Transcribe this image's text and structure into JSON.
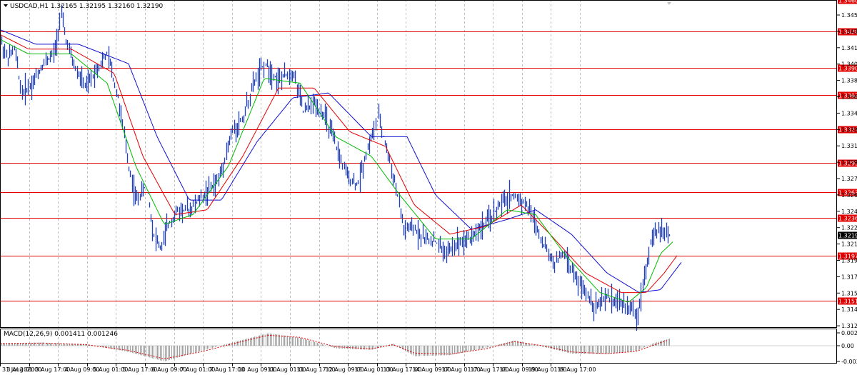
{
  "window": {
    "symbol_caption": "USDCAD,H1  1.32165 1.32195 1.32160 1.32190"
  },
  "macd": {
    "caption": "MACD(12,26,9) 0.001411 0.001246",
    "axis_labels": [
      "0.00245",
      "0.00",
      "-0.00330"
    ]
  },
  "price_axis": {
    "labels": [
      "1.34520",
      "1.34350",
      "1.34175",
      "1.34000",
      "1.33830",
      "1.33655",
      "1.33485",
      "1.33310",
      "1.33140",
      "1.32965",
      "1.32795",
      "1.32620",
      "1.32450",
      "1.32280",
      "1.32105",
      "1.31935",
      "1.31760",
      "1.31590",
      "1.31415",
      "1.31245"
    ],
    "current_price": "1.32190"
  },
  "levels": [
    {
      "label": "1.34604",
      "price": 1.34604
    },
    {
      "label": "1.34282",
      "price": 1.34282
    },
    {
      "label": "1.33908",
      "price": 1.33908
    },
    {
      "label": "1.33626",
      "price": 1.33626
    },
    {
      "label": "1.33278",
      "price": 1.33278
    },
    {
      "label": "1.32934",
      "price": 1.32934
    },
    {
      "label": "1.32633",
      "price": 1.32633
    },
    {
      "label": "1.32368",
      "price": 1.32368
    },
    {
      "label": "1.31978",
      "price": 1.31978
    },
    {
      "label": "1.31514",
      "price": 1.31514
    }
  ],
  "time_axis": {
    "labels": [
      "31 Jul 2020",
      "3 Aug 01:00",
      "3 Aug 17:00",
      "4 Aug 09:00",
      "5 Aug 01:00",
      "5 Aug 17:00",
      "6 Aug 09:00",
      "7 Aug 01:00",
      "7 Aug 17:00",
      "10 Aug 09:00",
      "11 Aug 01:00",
      "11 Aug 17:00",
      "12 Aug 09:00",
      "13 Aug 01:00",
      "13 Aug 17:00",
      "14 Aug 09:00",
      "17 Aug 01:00",
      "17 Aug 17:00",
      "18 Aug 09:00",
      "19 Aug 01:00",
      "19 Aug 17:00"
    ]
  },
  "colors": {
    "background": "#ffffff",
    "price_bars": "#1f3fbf",
    "level_line": "#e00000",
    "level_label_bg": "#e00000",
    "current_price_bg": "#000000",
    "ma_fast": "#00bb00",
    "ma_mid": "#e00000",
    "ma_slow": "#1010d0",
    "grid": "#bdbdbd",
    "macd_hist": "#a0a0a0",
    "macd_signal": "#e00000"
  },
  "chart_data": {
    "type": "line",
    "price_path": [
      [
        0,
        1.342
      ],
      [
        10,
        1.34
      ],
      [
        20,
        1.341
      ],
      [
        30,
        1.3365
      ],
      [
        45,
        1.3375
      ],
      [
        60,
        1.3395
      ],
      [
        75,
        1.3405
      ],
      [
        85,
        1.3445
      ],
      [
        95,
        1.341
      ],
      [
        105,
        1.339
      ],
      [
        120,
        1.337
      ],
      [
        135,
        1.339
      ],
      [
        150,
        1.3405
      ],
      [
        165,
        1.336
      ],
      [
        180,
        1.329
      ],
      [
        190,
        1.3255
      ],
      [
        205,
        1.327
      ],
      [
        215,
        1.322
      ],
      [
        225,
        1.3205
      ],
      [
        235,
        1.323
      ],
      [
        250,
        1.3245
      ],
      [
        265,
        1.3245
      ],
      [
        285,
        1.326
      ],
      [
        305,
        1.3275
      ],
      [
        325,
        1.3325
      ],
      [
        340,
        1.334
      ],
      [
        355,
        1.3375
      ],
      [
        370,
        1.3395
      ],
      [
        390,
        1.3378
      ],
      [
        410,
        1.3388
      ],
      [
        425,
        1.3345
      ],
      [
        440,
        1.3355
      ],
      [
        455,
        1.334
      ],
      [
        470,
        1.331
      ],
      [
        485,
        1.328
      ],
      [
        500,
        1.327
      ],
      [
        515,
        1.331
      ],
      [
        530,
        1.334
      ],
      [
        545,
        1.3295
      ],
      [
        555,
        1.3265
      ],
      [
        565,
        1.3225
      ],
      [
        580,
        1.3225
      ],
      [
        595,
        1.3215
      ],
      [
        610,
        1.3212
      ],
      [
        625,
        1.32
      ],
      [
        640,
        1.3212
      ],
      [
        655,
        1.3215
      ],
      [
        670,
        1.3225
      ],
      [
        685,
        1.3235
      ],
      [
        700,
        1.325
      ],
      [
        715,
        1.326
      ],
      [
        730,
        1.3255
      ],
      [
        745,
        1.324
      ],
      [
        760,
        1.321
      ],
      [
        775,
        1.319
      ],
      [
        790,
        1.32
      ],
      [
        805,
        1.3175
      ],
      [
        820,
        1.316
      ],
      [
        835,
        1.3145
      ],
      [
        850,
        1.3155
      ],
      [
        865,
        1.315
      ],
      [
        880,
        1.3145
      ],
      [
        892,
        1.3135
      ],
      [
        900,
        1.317
      ],
      [
        912,
        1.3215
      ],
      [
        925,
        1.3225
      ],
      [
        938,
        1.3219
      ]
    ],
    "ma_fast_path": [
      [
        0,
        1.342
      ],
      [
        40,
        1.3405
      ],
      [
        100,
        1.3405
      ],
      [
        150,
        1.3375
      ],
      [
        190,
        1.329
      ],
      [
        230,
        1.323
      ],
      [
        270,
        1.324
      ],
      [
        320,
        1.329
      ],
      [
        370,
        1.338
      ],
      [
        420,
        1.3375
      ],
      [
        470,
        1.332
      ],
      [
        520,
        1.33
      ],
      [
        560,
        1.326
      ],
      [
        610,
        1.3215
      ],
      [
        660,
        1.3215
      ],
      [
        710,
        1.3245
      ],
      [
        750,
        1.324
      ],
      [
        790,
        1.32
      ],
      [
        840,
        1.316
      ],
      [
        880,
        1.315
      ],
      [
        905,
        1.3165
      ],
      [
        925,
        1.32
      ],
      [
        942,
        1.3212
      ]
    ],
    "ma_mid_path": [
      [
        0,
        1.3425
      ],
      [
        40,
        1.341
      ],
      [
        100,
        1.341
      ],
      [
        160,
        1.3385
      ],
      [
        200,
        1.33
      ],
      [
        245,
        1.324
      ],
      [
        290,
        1.3245
      ],
      [
        340,
        1.33
      ],
      [
        390,
        1.337
      ],
      [
        440,
        1.337
      ],
      [
        490,
        1.3325
      ],
      [
        540,
        1.331
      ],
      [
        580,
        1.325
      ],
      [
        630,
        1.322
      ],
      [
        680,
        1.3228
      ],
      [
        730,
        1.325
      ],
      [
        770,
        1.322
      ],
      [
        820,
        1.318
      ],
      [
        870,
        1.316
      ],
      [
        905,
        1.316
      ],
      [
        930,
        1.318
      ],
      [
        948,
        1.3198
      ]
    ],
    "ma_slow_path": [
      [
        0,
        1.343
      ],
      [
        50,
        1.3415
      ],
      [
        110,
        1.3415
      ],
      [
        180,
        1.3395
      ],
      [
        220,
        1.332
      ],
      [
        265,
        1.3255
      ],
      [
        310,
        1.3255
      ],
      [
        360,
        1.3315
      ],
      [
        410,
        1.336
      ],
      [
        460,
        1.3365
      ],
      [
        520,
        1.332
      ],
      [
        570,
        1.332
      ],
      [
        610,
        1.326
      ],
      [
        660,
        1.3225
      ],
      [
        710,
        1.3235
      ],
      [
        750,
        1.3245
      ],
      [
        800,
        1.322
      ],
      [
        850,
        1.318
      ],
      [
        895,
        1.316
      ],
      [
        925,
        1.3163
      ],
      [
        955,
        1.3192
      ]
    ],
    "macd_histogram": [
      [
        0,
        0.0005
      ],
      [
        60,
        0.0006
      ],
      [
        120,
        0.0003
      ],
      [
        180,
        -0.0012
      ],
      [
        230,
        -0.003
      ],
      [
        280,
        -0.001
      ],
      [
        330,
        0.0008
      ],
      [
        375,
        0.0024
      ],
      [
        420,
        0.0015
      ],
      [
        470,
        -0.0005
      ],
      [
        520,
        -0.0008
      ],
      [
        550,
        0.0004
      ],
      [
        580,
        -0.002
      ],
      [
        630,
        -0.0018
      ],
      [
        680,
        -0.0004
      ],
      [
        720,
        0.001
      ],
      [
        760,
        -0.0002
      ],
      [
        800,
        -0.0015
      ],
      [
        850,
        -0.0016
      ],
      [
        890,
        -0.001
      ],
      [
        915,
        0.0005
      ],
      [
        938,
        0.0014
      ]
    ],
    "macd_signal": [
      [
        0,
        0.0004
      ],
      [
        60,
        0.0005
      ],
      [
        120,
        0.0002
      ],
      [
        180,
        -0.0009
      ],
      [
        230,
        -0.0025
      ],
      [
        280,
        -0.0012
      ],
      [
        330,
        0.0005
      ],
      [
        375,
        0.002
      ],
      [
        420,
        0.0016
      ],
      [
        470,
        -0.0002
      ],
      [
        520,
        -0.0006
      ],
      [
        550,
        0.0002
      ],
      [
        580,
        -0.0014
      ],
      [
        630,
        -0.0016
      ],
      [
        680,
        -0.0006
      ],
      [
        720,
        0.0008
      ],
      [
        760,
        0.0
      ],
      [
        800,
        -0.0012
      ],
      [
        850,
        -0.0015
      ],
      [
        890,
        -0.0011
      ],
      [
        915,
        0.0001
      ],
      [
        938,
        0.0012
      ]
    ],
    "ylim": [
      1.31245,
      1.34604
    ],
    "grid": true
  }
}
